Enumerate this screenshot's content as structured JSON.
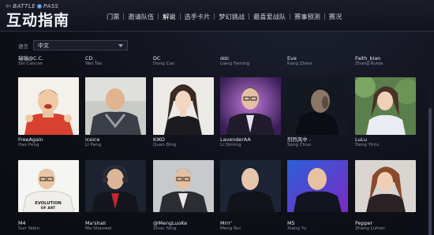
{
  "header": {
    "back_label": "BATTLE",
    "back_label2": "PASS",
    "title": "互动指南",
    "nav": [
      "门票",
      "邀请队伍",
      "解说",
      "选手卡片",
      "梦幻挑战",
      "最喜爱战队",
      "赛事预测",
      "赛况"
    ]
  },
  "language": {
    "label": "语言",
    "value": "中文"
  },
  "colors": {
    "bg": "#0d0f17",
    "accent": "#cfd3dd"
  },
  "top_names": [
    {
      "nick": "瑞瑞@C.C.",
      "real": "Shi Cancan"
    },
    {
      "nick": "CD",
      "real": "Wei Tao"
    },
    {
      "nick": "DC",
      "real": "Dong Can"
    },
    {
      "nick": "ddc",
      "real": "Liang Faming"
    },
    {
      "nick": "Eve",
      "real": "Kang Zhexi"
    },
    {
      "nick": "Faith_bian",
      "real": "Zhang Ruida"
    }
  ],
  "row1": [
    {
      "nick": "FreeAgain",
      "real": "Hao Peng"
    },
    {
      "nick": "iceice",
      "real": "Li Peng"
    },
    {
      "nick": "KIKO",
      "real": "Quan Bing"
    },
    {
      "nick": "LavenderAA",
      "real": "Li Qiming"
    },
    {
      "nick": "烈烈风中 -",
      "real": "Song Chun"
    },
    {
      "nick": "LuLu",
      "real": "Deng Yinlu"
    }
  ],
  "row2": [
    {
      "nick": "M4",
      "real": "Sun Yabin"
    },
    {
      "nick": "Ma'shall",
      "real": "Ma Shaowei"
    },
    {
      "nick": "@MengLuoKe",
      "real": "Zhou Yang"
    },
    {
      "nick": "Mrrr'",
      "real": "Meng Rui"
    },
    {
      "nick": "MS",
      "real": "Xiang Yu"
    },
    {
      "nick": "Pepper",
      "real": "Zhang Lizhen"
    }
  ],
  "photo_texts": {
    "shirt": [
      "EVOLUTION",
      "OF ART"
    ]
  }
}
